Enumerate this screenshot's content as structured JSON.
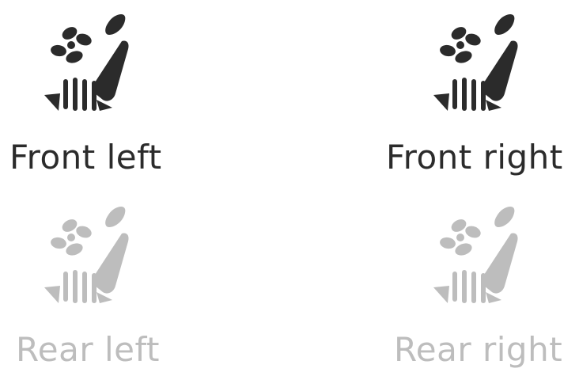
{
  "colors": {
    "active": "#2b2b2b",
    "inactive": "#bdbdbd",
    "background": "#ffffff"
  },
  "seats": [
    {
      "label": "Front left",
      "state": "active",
      "icon": "seat-heater-icon"
    },
    {
      "label": "Front right",
      "state": "active",
      "icon": "seat-heater-icon"
    },
    {
      "label": "Rear left",
      "state": "inactive",
      "icon": "seat-heater-icon"
    },
    {
      "label": "Rear right",
      "state": "inactive",
      "icon": "seat-heater-icon"
    }
  ]
}
